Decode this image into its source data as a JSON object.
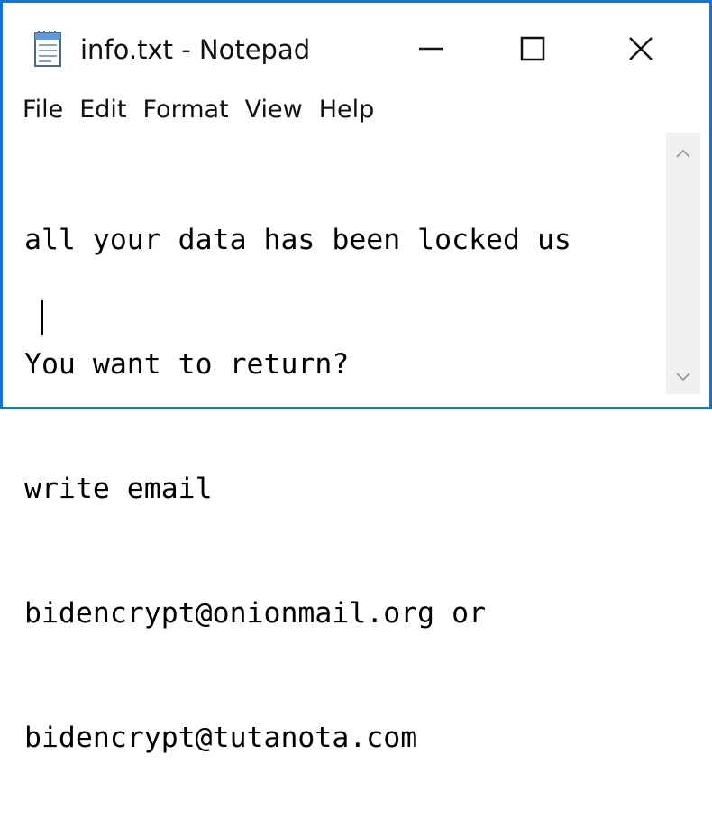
{
  "window": {
    "title": "info.txt - Notepad",
    "accent_color": "#1a6fd4"
  },
  "caption_buttons": {
    "minimize_icon": "minimize-icon",
    "maximize_icon": "maximize-icon",
    "close_icon": "close-icon"
  },
  "menu": {
    "items": [
      "File",
      "Edit",
      "Format",
      "View",
      "Help"
    ]
  },
  "editor": {
    "lines": [
      "all your data has been locked us",
      "You want to return?",
      "write email",
      "bidencrypt@onionmail.org or",
      "bidencrypt@tutanota.com"
    ]
  },
  "scrollbar": {
    "up_icon": "chevron-up-icon",
    "down_icon": "chevron-down-icon"
  }
}
